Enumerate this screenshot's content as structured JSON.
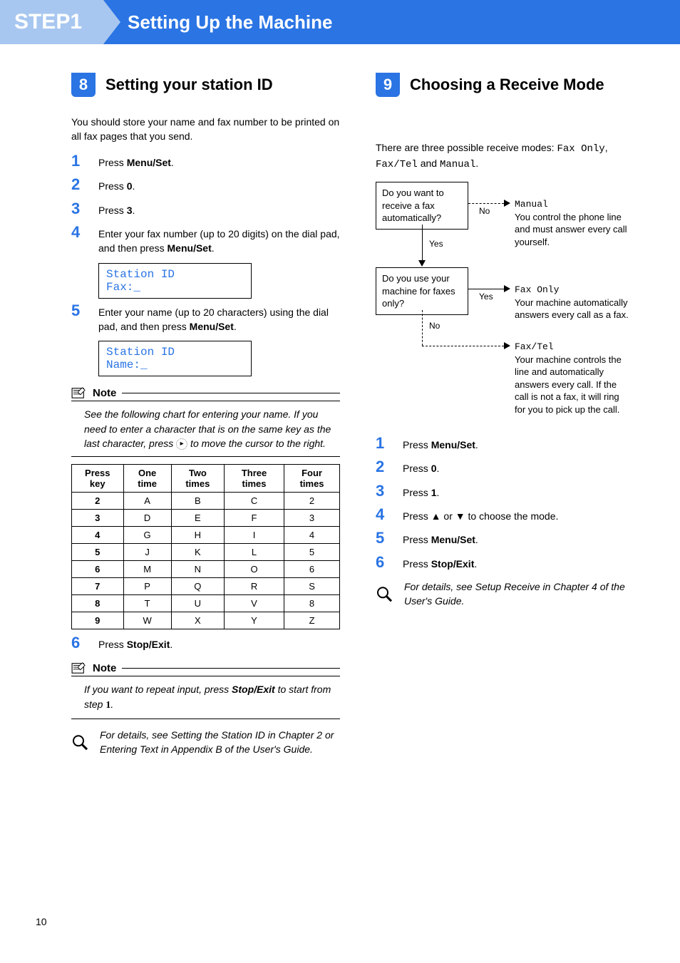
{
  "header": {
    "step": "STEP1",
    "title": "Setting Up the Machine"
  },
  "left": {
    "secNum": "8",
    "secTitle": "Setting your station ID",
    "intro": "You should store your name and fax number to be printed on all fax pages that you send.",
    "steps": {
      "s1": {
        "pre": "Press ",
        "b": "Menu/Set",
        "post": "."
      },
      "s2": {
        "pre": "Press ",
        "b": "0",
        "post": "."
      },
      "s3": {
        "pre": "Press ",
        "b": "3",
        "post": "."
      },
      "s4": {
        "pre": "Enter your fax number (up to 20 digits) on the dial pad, and then press ",
        "b": "Menu/Set",
        "post": "."
      },
      "s5": {
        "pre": "Enter your name (up to 20 characters) using the dial pad, and then press ",
        "b": "Menu/Set",
        "post": "."
      },
      "s6": {
        "pre": "Press ",
        "b": "Stop/Exit",
        "post": "."
      }
    },
    "display1": "Station ID\nFax:_",
    "display2": "Station ID\nName:_",
    "noteLabel": "Note",
    "note1a": "See the following chart for entering your name. If you need to enter a character that is on the same key as the last character, press ",
    "note1b": " to move the cursor to the right.",
    "table": {
      "headers": [
        "Press key",
        "One time",
        "Two times",
        "Three times",
        "Four times"
      ],
      "rows": [
        [
          "2",
          "A",
          "B",
          "C",
          "2"
        ],
        [
          "3",
          "D",
          "E",
          "F",
          "3"
        ],
        [
          "4",
          "G",
          "H",
          "I",
          "4"
        ],
        [
          "5",
          "J",
          "K",
          "L",
          "5"
        ],
        [
          "6",
          "M",
          "N",
          "O",
          "6"
        ],
        [
          "7",
          "P",
          "Q",
          "R",
          "S"
        ],
        [
          "8",
          "T",
          "U",
          "V",
          "8"
        ],
        [
          "9",
          "W",
          "X",
          "Y",
          "Z"
        ]
      ]
    },
    "note2a": "If you want to repeat input, press ",
    "note2b": "Stop/Exit",
    "note2c": " to start from step ",
    "note2d": "1",
    "note2e": ".",
    "ref": "For details, see Setting the Station ID in Chapter 2 or Entering Text in Appendix B of the User's Guide."
  },
  "right": {
    "secNum": "9",
    "secTitle": "Choosing a Receive Mode",
    "introA": "There are three possible receive modes: ",
    "introB": "Fax Only",
    "introC": ", ",
    "introD": "Fax/Tel",
    "introE": " and ",
    "introF": "Manual",
    "introG": ".",
    "fc": {
      "q1": "Do you want to receive a fax automatically?",
      "q2": "Do you use your machine for faxes only?",
      "no": "No",
      "yes": "Yes",
      "manual": "Manual",
      "manualDesc": "You control the phone line and must answer every call yourself.",
      "faxOnly": "Fax Only",
      "faxOnlyDesc": "Your machine automatically answers every call as a fax.",
      "faxTel": "Fax/Tel",
      "faxTelDesc": "Your machine controls the line and automatically answers every call. If the call is not a fax, it will ring for you to pick up the call."
    },
    "steps": {
      "s1": {
        "pre": "Press ",
        "b": "Menu/Set",
        "post": "."
      },
      "s2": {
        "pre": "Press ",
        "b": "0",
        "post": "."
      },
      "s3": {
        "pre": "Press ",
        "b": "1",
        "post": "."
      },
      "s4": {
        "full": "Press ▲ or ▼ to choose the mode."
      },
      "s5": {
        "pre": "Press ",
        "b": "Menu/Set",
        "post": "."
      },
      "s6": {
        "pre": "Press ",
        "b": "Stop/Exit",
        "post": "."
      }
    },
    "ref": "For details, see Setup Receive in Chapter 4 of the User's Guide."
  },
  "pageNum": "10"
}
